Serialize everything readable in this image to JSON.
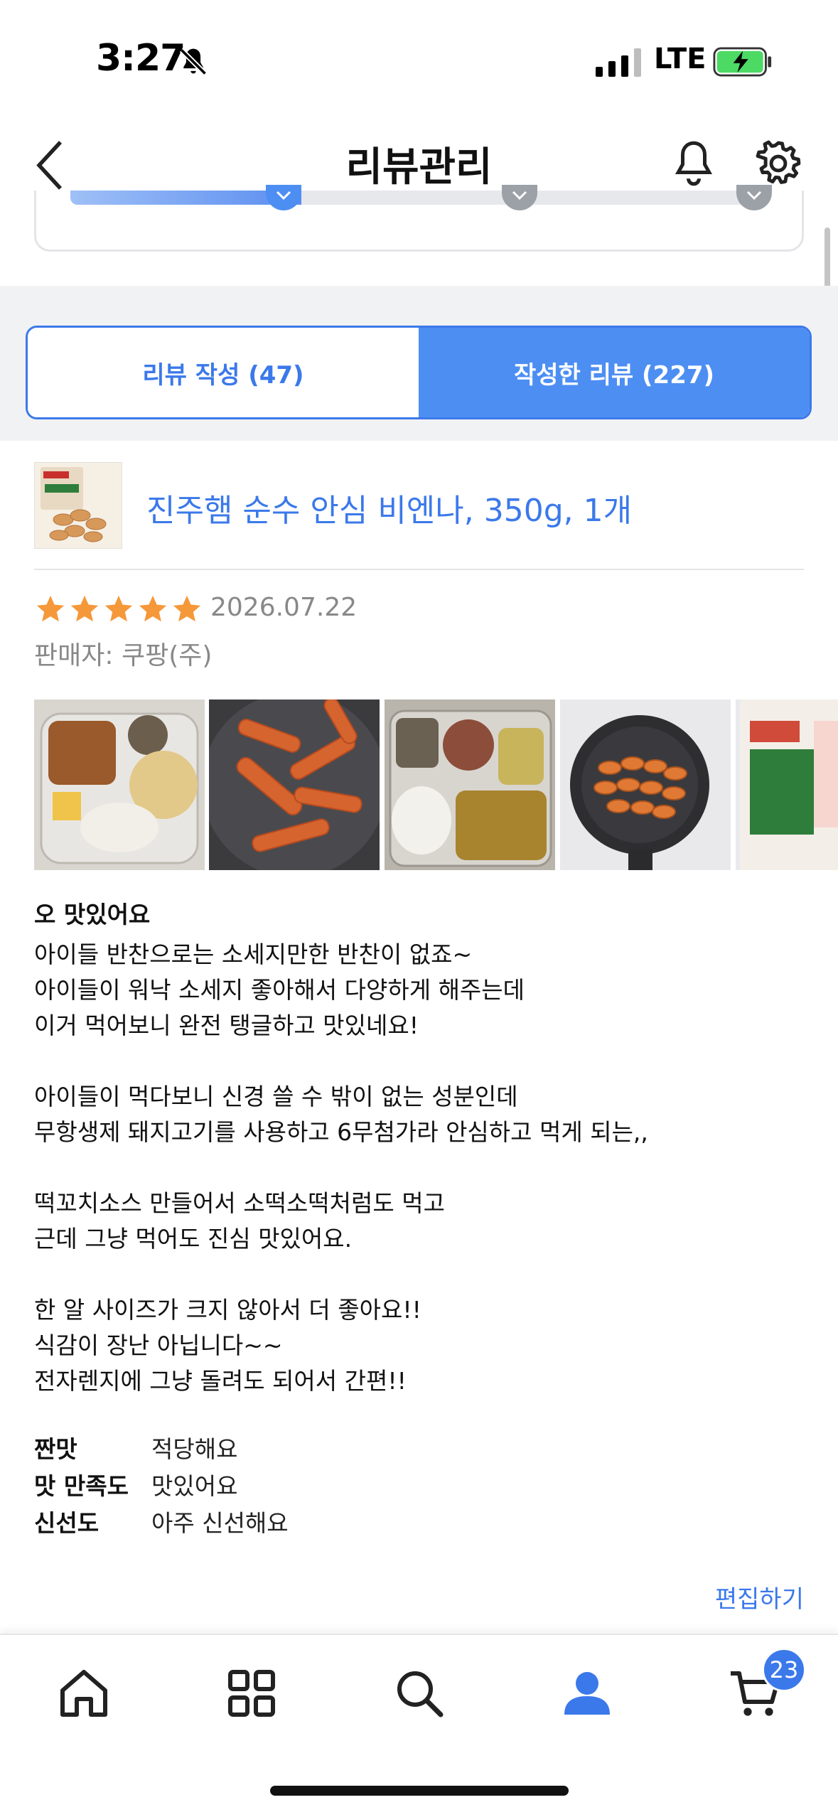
{
  "status_bar": {
    "time": "3:27",
    "network": "LTE"
  },
  "header": {
    "title": "리뷰관리"
  },
  "tabs": [
    {
      "label": "리뷰 작성 (47)",
      "active": false
    },
    {
      "label": "작성한 리뷰 (227)",
      "active": true
    }
  ],
  "progress": {
    "fraction": 0.33,
    "steps": 3,
    "completed_steps": 1
  },
  "product": {
    "name": "진주햄 순수 안심 비엔나, 350g, 1개",
    "thumb_label": "순수안심"
  },
  "review": {
    "rating": 5,
    "date": "2026.07.22",
    "seller_label": "판매자:",
    "seller_name": "쿠팡(주)",
    "photos": [
      "school-lunch-tray",
      "tteokbokki-pan",
      "lunch-tray-with-sausage",
      "sausages-in-pan",
      "product-package"
    ],
    "headline": "오 맛있어요",
    "body": [
      "아이들 반찬으로는 소세지만한 반찬이 없죠~",
      "아이들이 워낙 소세지 좋아해서 다양하게 해주는데",
      "이거 먹어보니 완전 탱글하고 맛있네요!",
      "",
      "아이들이 먹다보니 신경 쓸 수 밖이 없는 성분인데",
      "무항생제 돼지고기를 사용하고 6무첨가라 안심하고 먹게 되는,,",
      "",
      "떡꼬치소스 만들어서 소떡소떡처럼도 먹고",
      "근데 그냥 먹어도 진심 맛있어요.",
      "",
      "한 알 사이즈가 크지 않아서 더 좋아요!!",
      "식감이 장난 아닙니다~~",
      "전자렌지에 그냥 돌려도 되어서 간편!!"
    ],
    "attributes": [
      {
        "key": "짠맛",
        "value": "적당해요"
      },
      {
        "key": "맛 만족도",
        "value": "맛있어요"
      },
      {
        "key": "신선도",
        "value": "아주 신선해요"
      }
    ],
    "edit_label": "편집하기"
  },
  "bottom_nav": {
    "items": [
      "home-icon",
      "category-grid-icon",
      "search-icon",
      "my-account-icon",
      "cart-icon"
    ],
    "active": "my-account-icon",
    "cart_count": "23"
  },
  "colors": {
    "accent": "#3b79ea",
    "star": "#f5983a",
    "muted": "#888888"
  }
}
